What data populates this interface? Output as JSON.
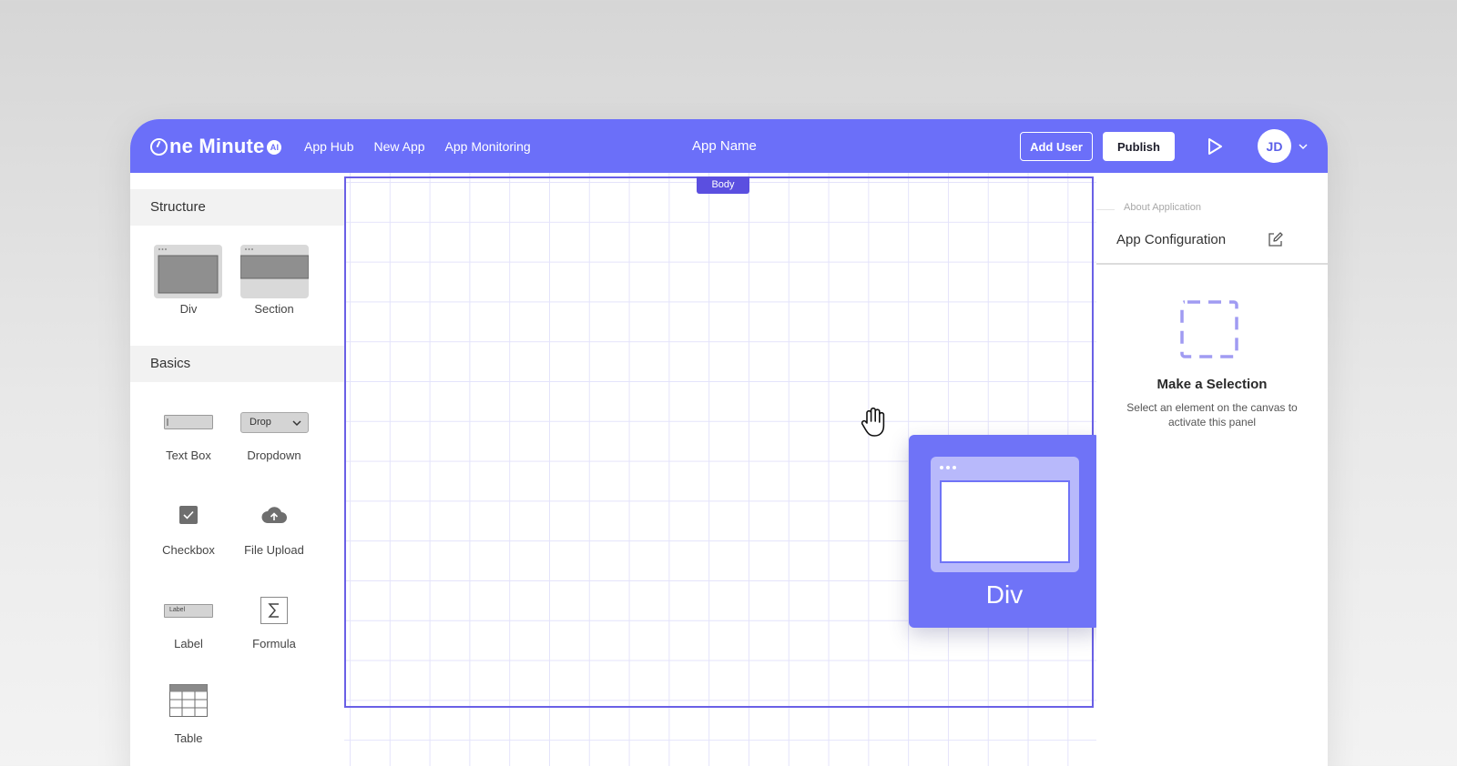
{
  "brand": {
    "logo_text": "ne Minute",
    "logo_badge": "AI"
  },
  "nav": {
    "items": [
      "App Hub",
      "New App",
      "App Monitoring"
    ]
  },
  "header": {
    "app_name": "App Name",
    "add_user_label": "Add User",
    "publish_label": "Publish",
    "avatar_initials": "JD"
  },
  "sidebar": {
    "structure_title": "Structure",
    "structure_items": [
      "Div",
      "Section"
    ],
    "basics_title": "Basics",
    "basics_items": [
      "Text Box",
      "Dropdown",
      "Checkbox",
      "File Upload",
      "Label",
      "Formula",
      "Table"
    ],
    "dropdown_preview": "Drop",
    "label_preview": "Label"
  },
  "canvas": {
    "body_tag": "Body",
    "drag_card_label": "Div"
  },
  "right_panel": {
    "about": "About Application",
    "title": "App Configuration",
    "empty_title": "Make a Selection",
    "empty_desc": "Select an element on the canvas to activate this panel"
  },
  "colors": {
    "accent": "#6b6ff9",
    "accent_dark": "#5b4fe0",
    "grid": "#e4e3fb"
  }
}
